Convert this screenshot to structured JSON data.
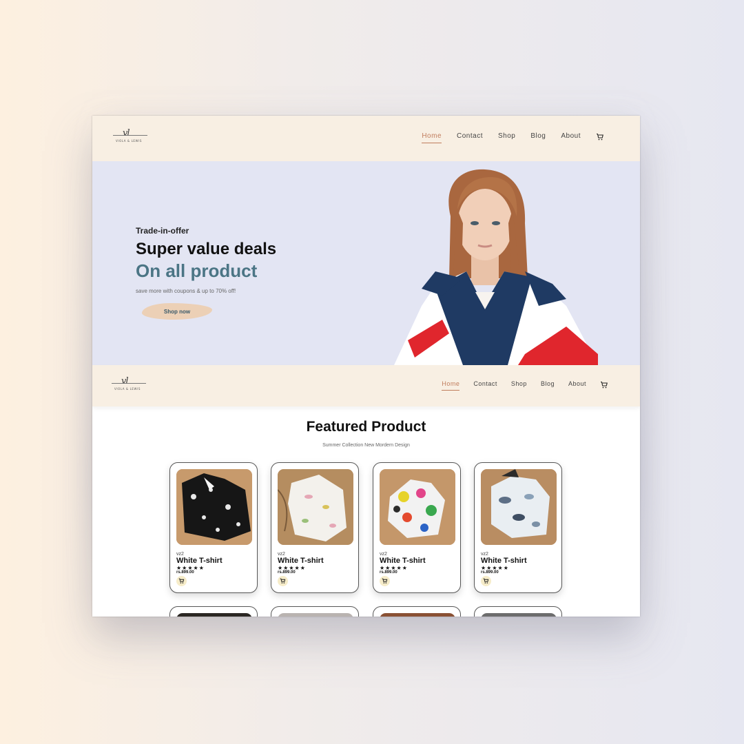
{
  "brand_logo": {
    "monogram": "vl",
    "text": "VIOLA & LEWIS"
  },
  "nav": {
    "items": [
      {
        "label": "Home",
        "active": true
      },
      {
        "label": "Contact",
        "active": false
      },
      {
        "label": "Shop",
        "active": false
      },
      {
        "label": "Blog",
        "active": false
      },
      {
        "label": "About",
        "active": false
      }
    ],
    "cart_icon": "cart-icon"
  },
  "hero": {
    "kicker": "Trade-in-offer",
    "heading": "Super value deals",
    "heading_accent": "On all product",
    "description": "save more with coupons & up to 70% off!",
    "button_label": "Shop now"
  },
  "featured": {
    "title": "Featured Product",
    "subtitle": "Summer Collection New Mordern Design",
    "products": [
      {
        "brand": "vz2",
        "name": "White T-shirt",
        "stars": "★★★★★",
        "price": "rs.899.00"
      },
      {
        "brand": "vz2",
        "name": "White T-shirt",
        "stars": "★★★★★",
        "price": "rs.899.00"
      },
      {
        "brand": "vz2",
        "name": "White T-shirt",
        "stars": "★★★★★",
        "price": "rs.899.00"
      },
      {
        "brand": "vz2",
        "name": "White T-shirt",
        "stars": "★★★★★",
        "price": "rs.899.00"
      }
    ]
  },
  "colors": {
    "nav_bg": "#f8efe3",
    "hero_bg": "#e3e5f3",
    "accent": "#c07c5c",
    "heading_accent": "#4b7585",
    "button_bg": "#ecd0b6"
  }
}
